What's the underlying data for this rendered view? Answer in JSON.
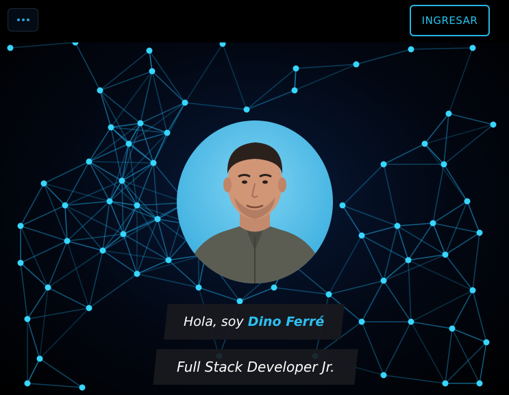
{
  "header": {
    "menu_icon": "ellipsis-icon",
    "login_label": "INGRESAR"
  },
  "hero": {
    "greeting_prefix": "Hola, soy ",
    "name": "Dino Ferré",
    "role": "Full Stack Developer Jr.",
    "avatar_alt": "Dino Ferré"
  },
  "colors": {
    "accent": "#27c3f0",
    "background": "#000000",
    "tag_background": "#181a1e",
    "network_line": "#1fa9e0"
  }
}
